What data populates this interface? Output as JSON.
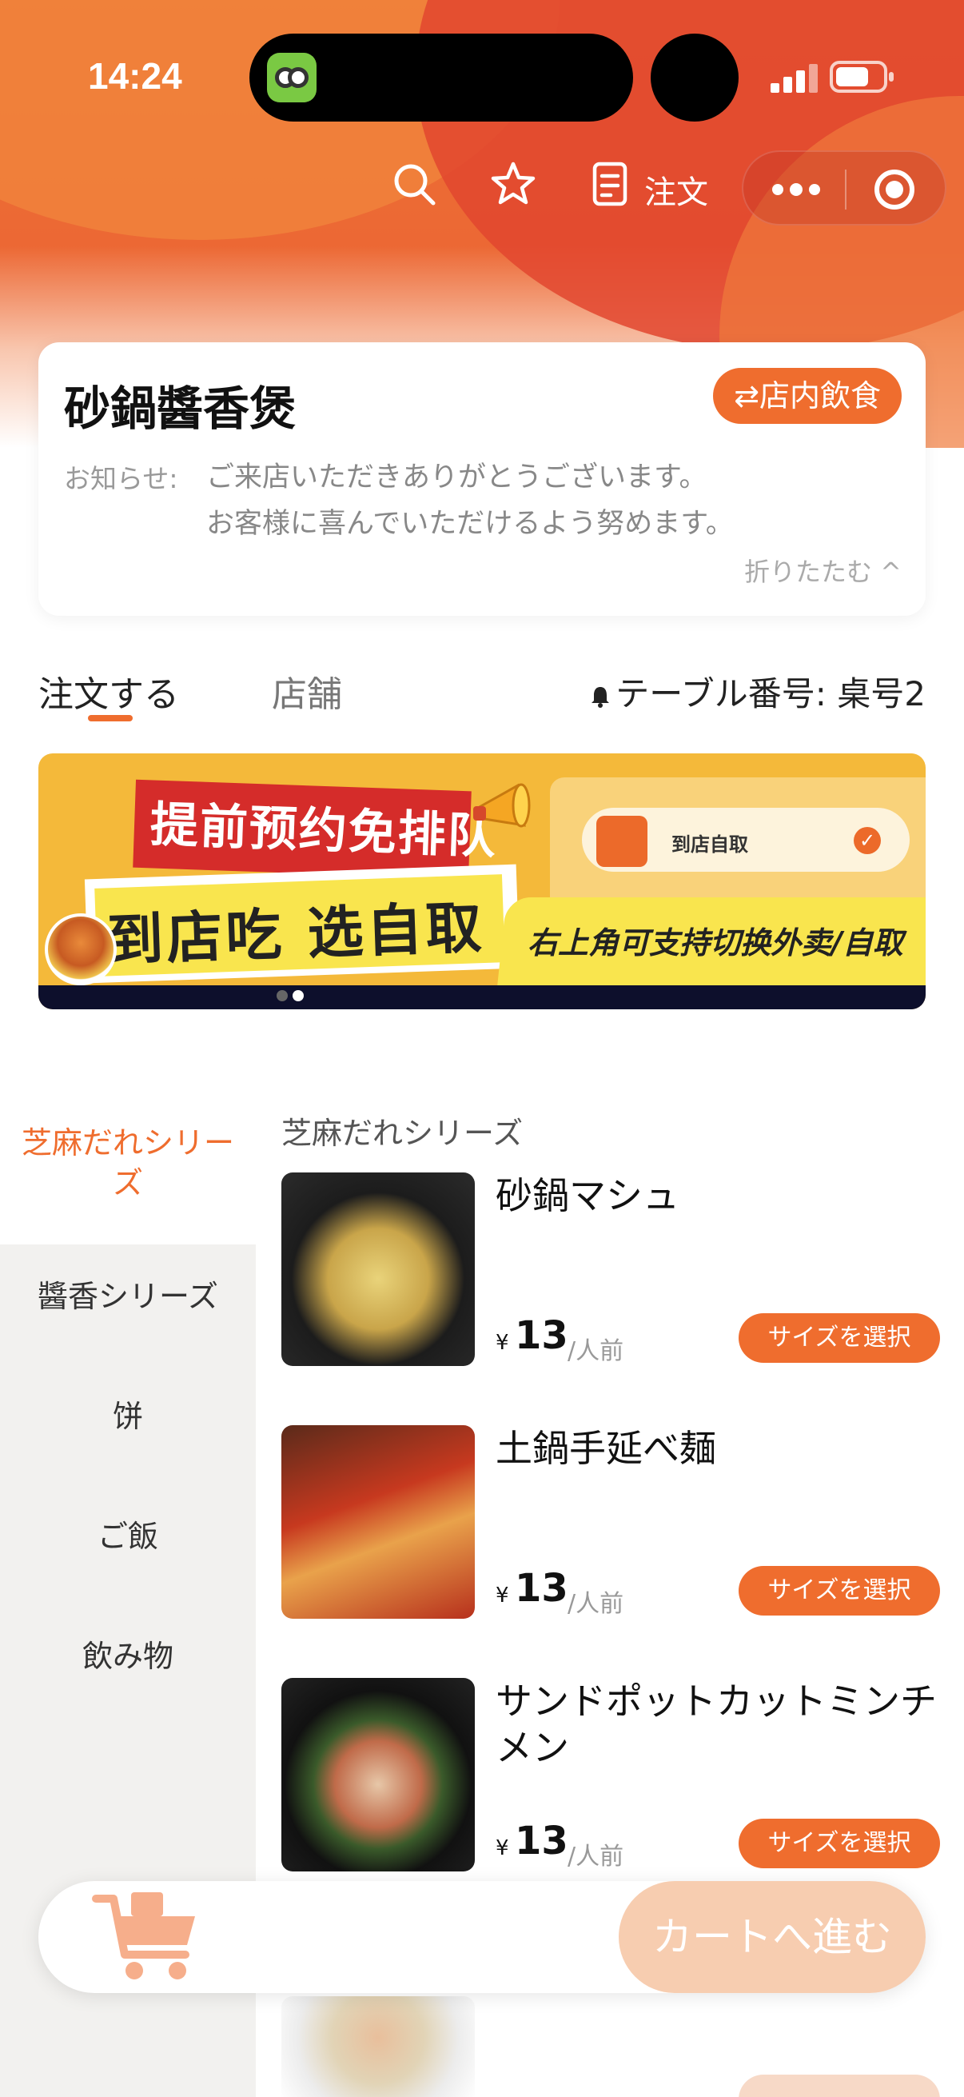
{
  "status_bar": {
    "time": "14:24"
  },
  "top_nav": {
    "order_label": "注文"
  },
  "store": {
    "name": "砂鍋醬香煲",
    "dine_mode": "⇄店内飲食",
    "notice_label": "お知らせ:",
    "notice_text": "ご来店いただきありがとうございます。お客様に喜んでいただけるよう努めます。",
    "fold_label": "折りたたむ ^"
  },
  "tabs": [
    {
      "label": "注文する",
      "active": true
    },
    {
      "label": "店舗",
      "active": false
    }
  ],
  "table_number": "テーブル番号:  桌号2",
  "banner": {
    "headline": "提前预约免排队",
    "main": "到店吃  选自取",
    "pickup_option": "到店自取",
    "side_text": "右上角可支持切换外卖/自取",
    "page_count": 2,
    "active_page": 2
  },
  "categories": [
    {
      "label": "芝麻だれシリーズ",
      "active": true
    },
    {
      "label": "醬香シリーズ",
      "active": false
    },
    {
      "label": "饼",
      "active": false
    },
    {
      "label": "ご飯",
      "active": false
    },
    {
      "label": "飲み物",
      "active": false
    }
  ],
  "section_title": "芝麻だれシリーズ",
  "products": [
    {
      "name": "砂鍋マシュ",
      "currency": "¥",
      "price": "13",
      "unit": "/人前",
      "button": "サイズを選択"
    },
    {
      "name": "土鍋手延べ麺",
      "currency": "¥",
      "price": "13",
      "unit": "/人前",
      "button": "サイズを選択"
    },
    {
      "name": "サンドポットカットミンチメン",
      "currency": "¥",
      "price": "13",
      "unit": "/人前",
      "button": "サイズを選択"
    }
  ],
  "cart": {
    "checkout_label": "カートへ進む"
  },
  "colors": {
    "accent": "#ef6d2e",
    "header": "#e8552f",
    "sidebar_bg": "#f2f1ef"
  }
}
